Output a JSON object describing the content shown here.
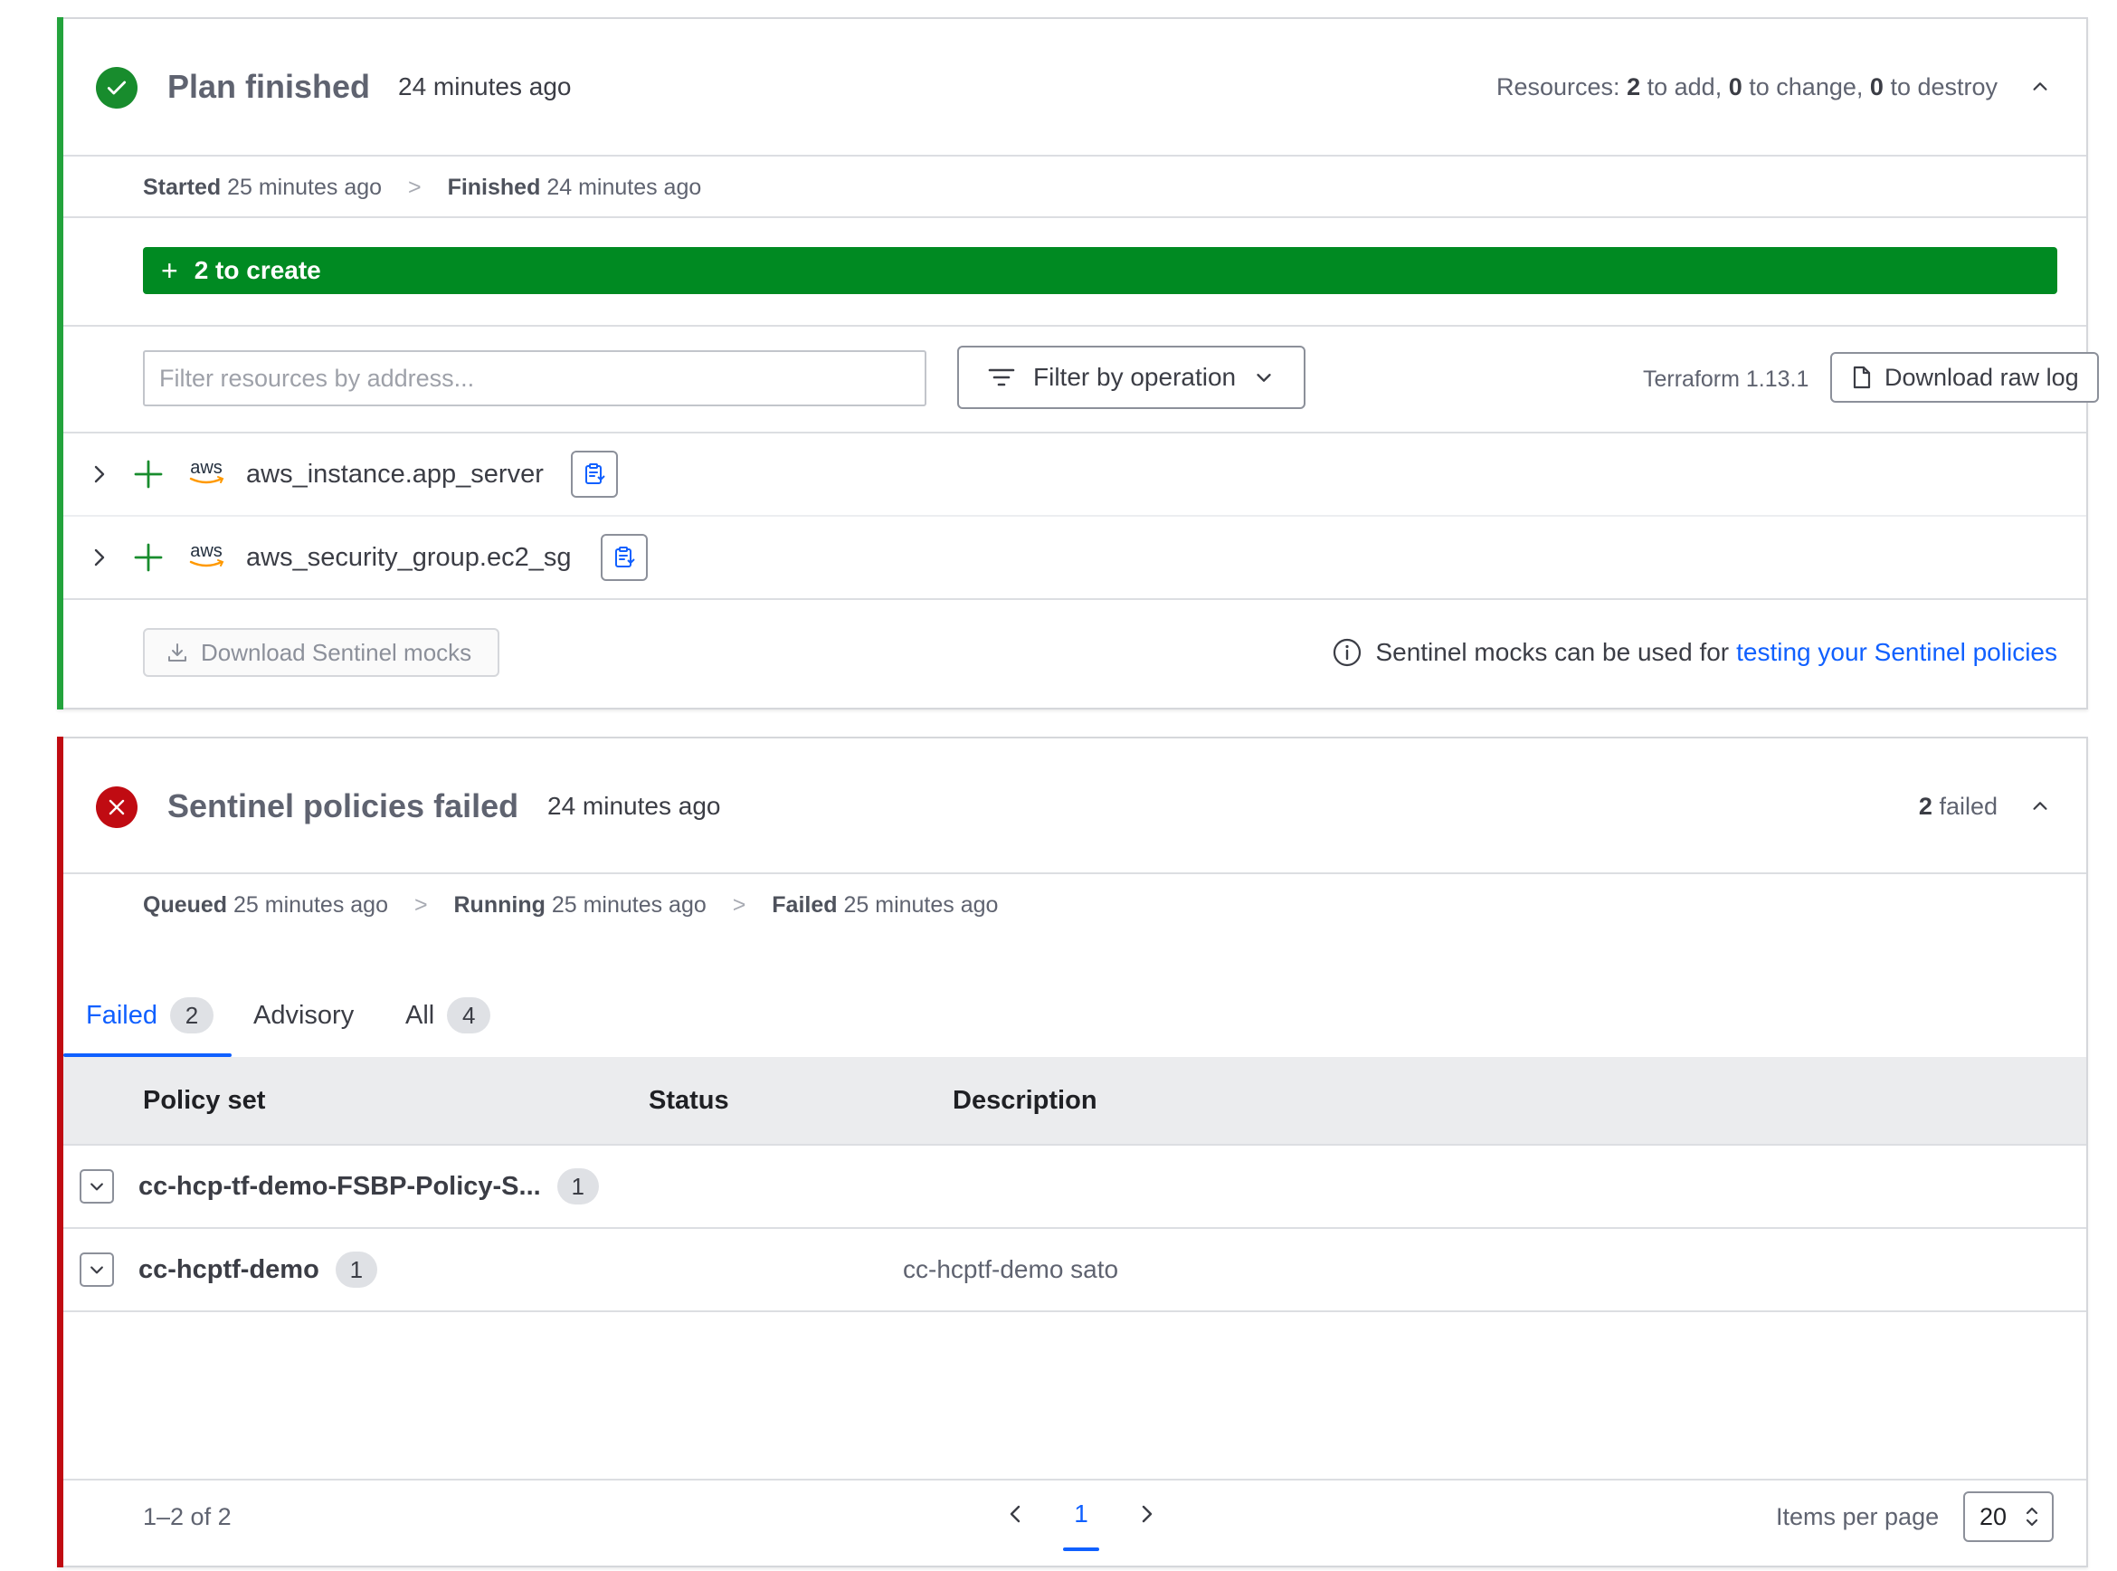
{
  "plan": {
    "title": "Plan finished",
    "time": "24 minutes ago",
    "resources_prefix": "Resources:",
    "add_count": "2",
    "add_label": "to add,",
    "change_count": "0",
    "change_label": "to change,",
    "destroy_count": "0",
    "destroy_label": "to destroy",
    "timeline": {
      "started_label": "Started",
      "started_time": "25 minutes ago",
      "sep": ">",
      "finished_label": "Finished",
      "finished_time": "24 minutes ago"
    },
    "create_bar": {
      "plus": "+",
      "label": "2 to create"
    },
    "filter_placeholder": "Filter resources by address...",
    "filter_op_label": "Filter by operation",
    "terraform_version": "Terraform 1.13.1",
    "download_raw_log": "Download raw log",
    "resources": [
      {
        "provider": "aws",
        "address": "aws_instance.app_server"
      },
      {
        "provider": "aws",
        "address": "aws_security_group.ec2_sg"
      }
    ],
    "download_mocks": "Download Sentinel mocks",
    "mocks_info_text": "Sentinel mocks can be used for",
    "mocks_link": "testing your Sentinel policies"
  },
  "sentinel": {
    "title": "Sentinel policies failed",
    "time": "24 minutes ago",
    "failed_count": "2",
    "failed_label": "failed",
    "timeline": {
      "queued_label": "Queued",
      "queued_time": "25 minutes ago",
      "sep": ">",
      "running_label": "Running",
      "running_time": "25 minutes ago",
      "failed_label": "Failed",
      "failed_time": "25 minutes ago"
    },
    "tabs": [
      {
        "label": "Failed",
        "count": "2",
        "active": true
      },
      {
        "label": "Advisory"
      },
      {
        "label": "All",
        "count": "4"
      }
    ],
    "columns": [
      "Policy set",
      "Status",
      "Description"
    ],
    "rows": [
      {
        "name": "cc-hcp-tf-demo-FSBP-Policy-S...",
        "count": "1",
        "description": ""
      },
      {
        "name": "cc-hcptf-demo",
        "count": "1",
        "description": "cc-hcptf-demo sato"
      }
    ],
    "range": "1–2 of 2",
    "page": "1",
    "items_per_page_label": "Items per page",
    "items_per_page": "20"
  },
  "colors": {
    "success": "#188c2d",
    "create_bar": "#008a22",
    "danger": "#c00b12",
    "link": "#1060ff"
  }
}
